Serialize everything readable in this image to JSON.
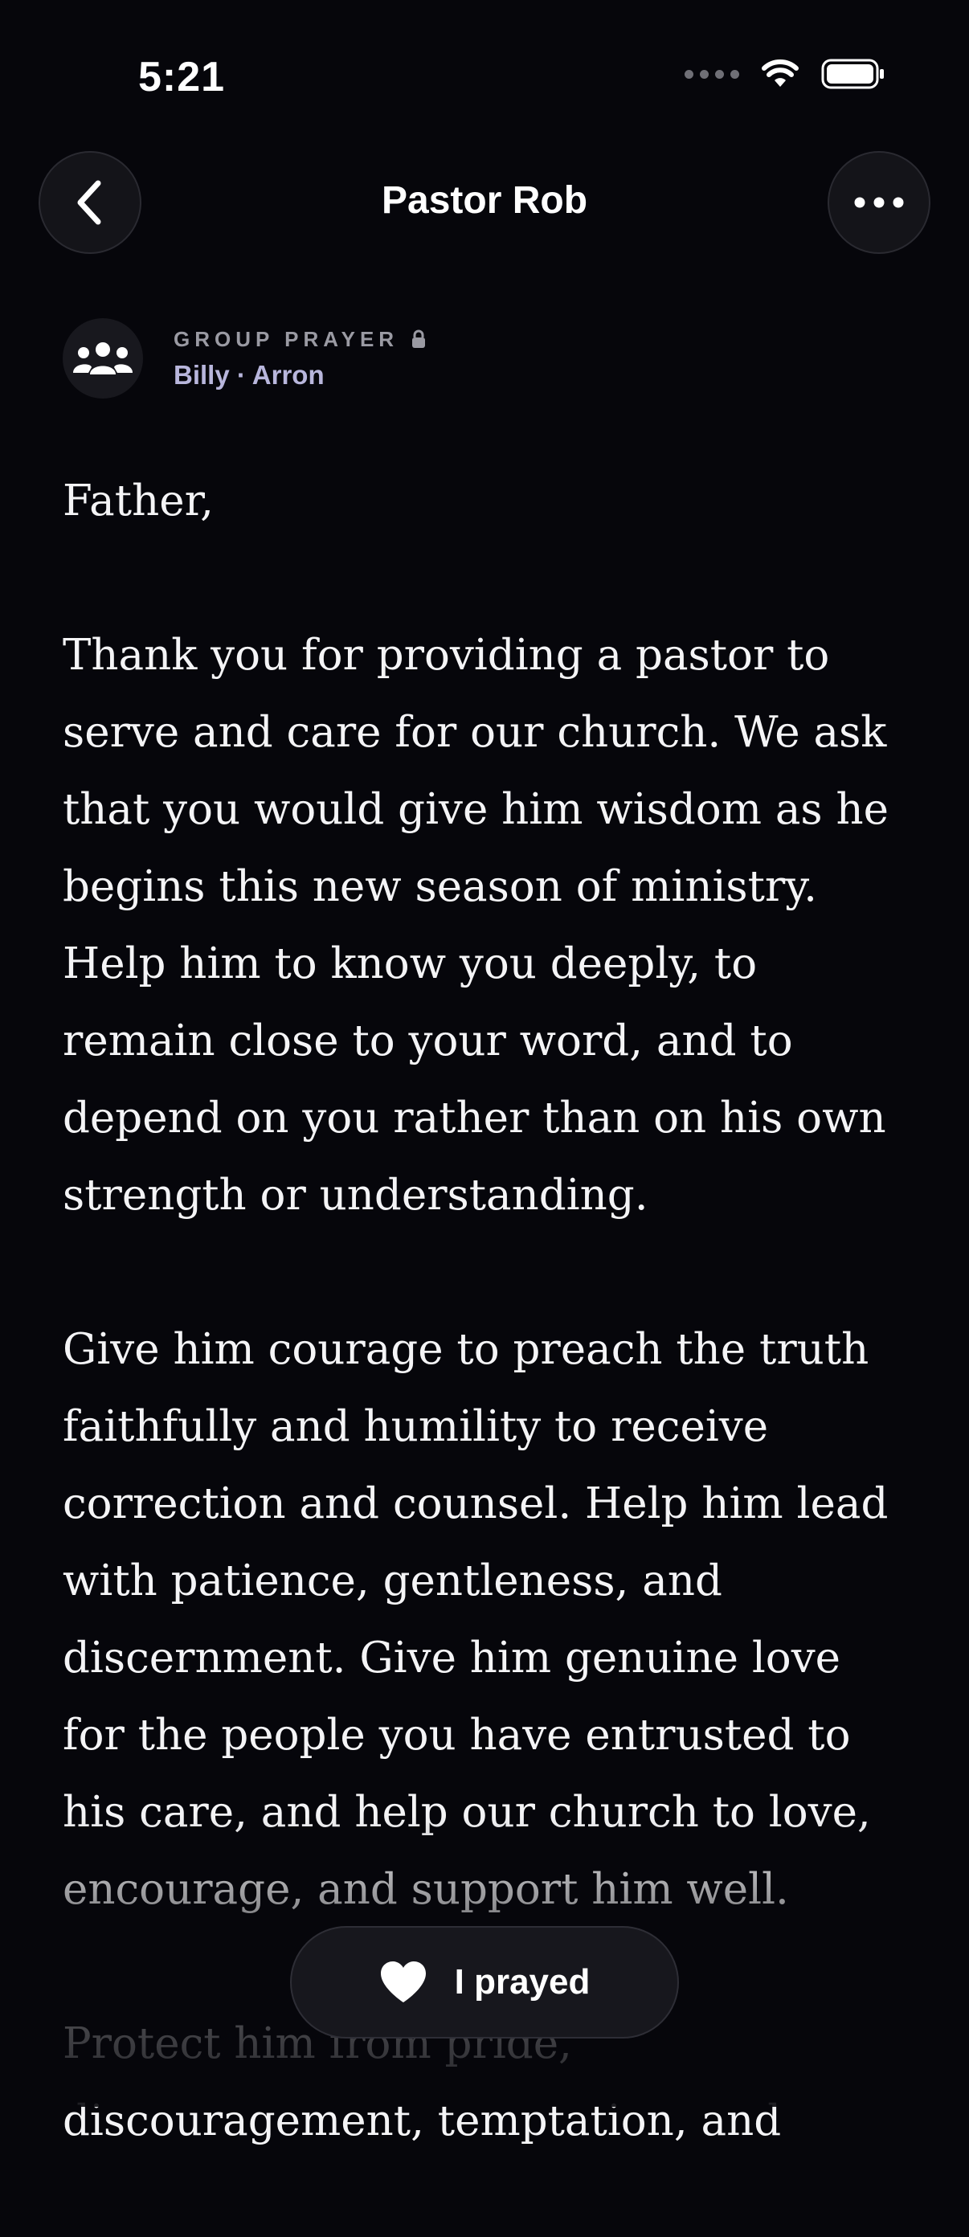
{
  "status": {
    "time": "5:21"
  },
  "nav": {
    "title": "Pastor Rob",
    "back_icon": "chevron-left-icon",
    "more_icon": "ellipsis-icon"
  },
  "meta": {
    "label": "GROUP PRAYER",
    "members": "Billy · Arron",
    "avatar_icon": "group-icon",
    "lock_icon": "lock-icon"
  },
  "prayer": {
    "greeting": "Father,",
    "paragraphs": [
      "Thank you for providing a pastor to serve and care for our church. We ask that you would give him wisdom as he begins this new season of ministry. Help him to know you deeply, to remain close to your word, and to depend on you rather than on his own strength or understanding.",
      "Give him courage to preach the truth faithfully and humility to receive correction and counsel. Help him lead with patience, gentleness, and discernment. Give him genuine love for the people you have entrusted to his care, and help our church to love, encourage, and support him well.",
      "Protect him from pride, discouragement, temptation, and"
    ]
  },
  "action": {
    "label": "I prayed",
    "icon": "heart-icon"
  },
  "colors": {
    "background": "#06060b",
    "accent_text": "#b8b6dc"
  }
}
